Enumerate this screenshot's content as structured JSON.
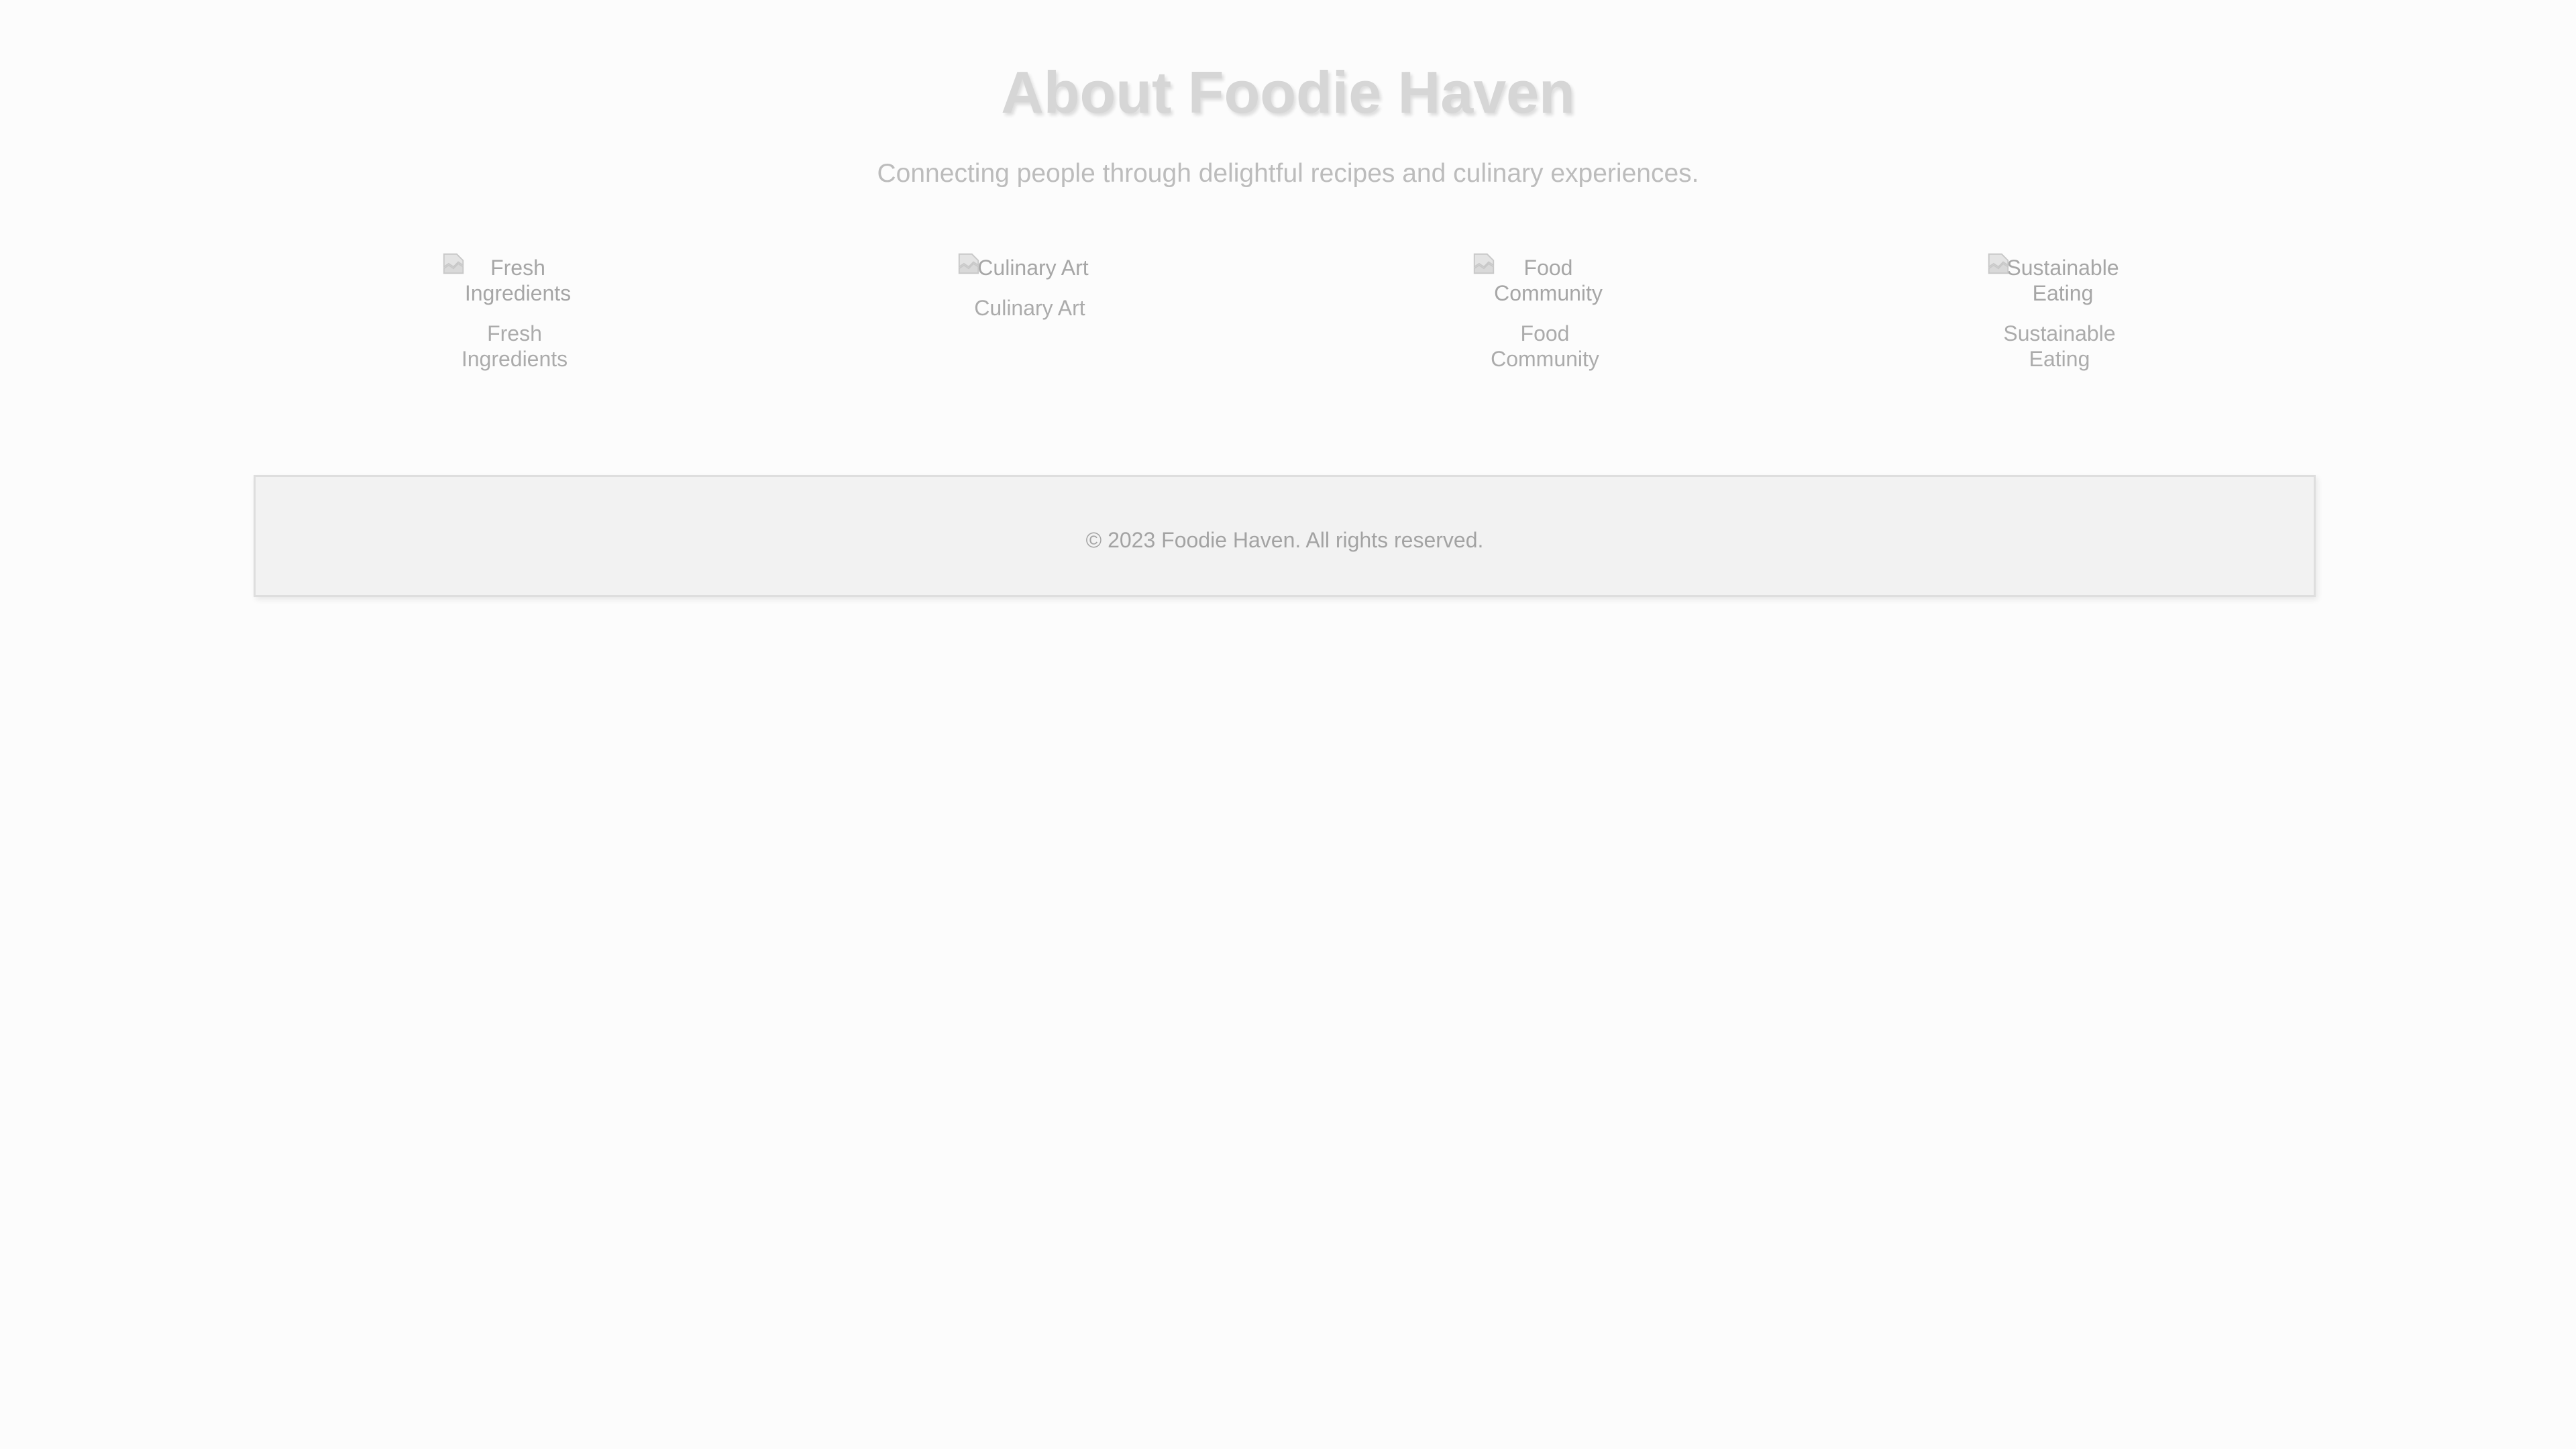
{
  "header": {
    "title": "About Foodie Haven",
    "subtitle": "Connecting people through delightful recipes and culinary experiences."
  },
  "features": [
    {
      "image_alt": "Fresh Ingredients",
      "caption": "Fresh Ingredients",
      "icon": "broken-image-icon"
    },
    {
      "image_alt": "Culinary Art",
      "caption": "Culinary Art",
      "icon": "broken-image-icon"
    },
    {
      "image_alt": "Food Community",
      "caption": "Food Community",
      "icon": "broken-image-icon"
    },
    {
      "image_alt": "Sustainable Eating",
      "caption": "Sustainable Eating",
      "icon": "broken-image-icon"
    }
  ],
  "footer": {
    "text": "© 2023 Foodie Haven. All rights reserved."
  },
  "colors": {
    "background": "#fcfcfc",
    "title": "#d6d6d6",
    "text": "#a6a6a6",
    "footer_bg": "#f2f2f2",
    "footer_border": "#dedede"
  }
}
